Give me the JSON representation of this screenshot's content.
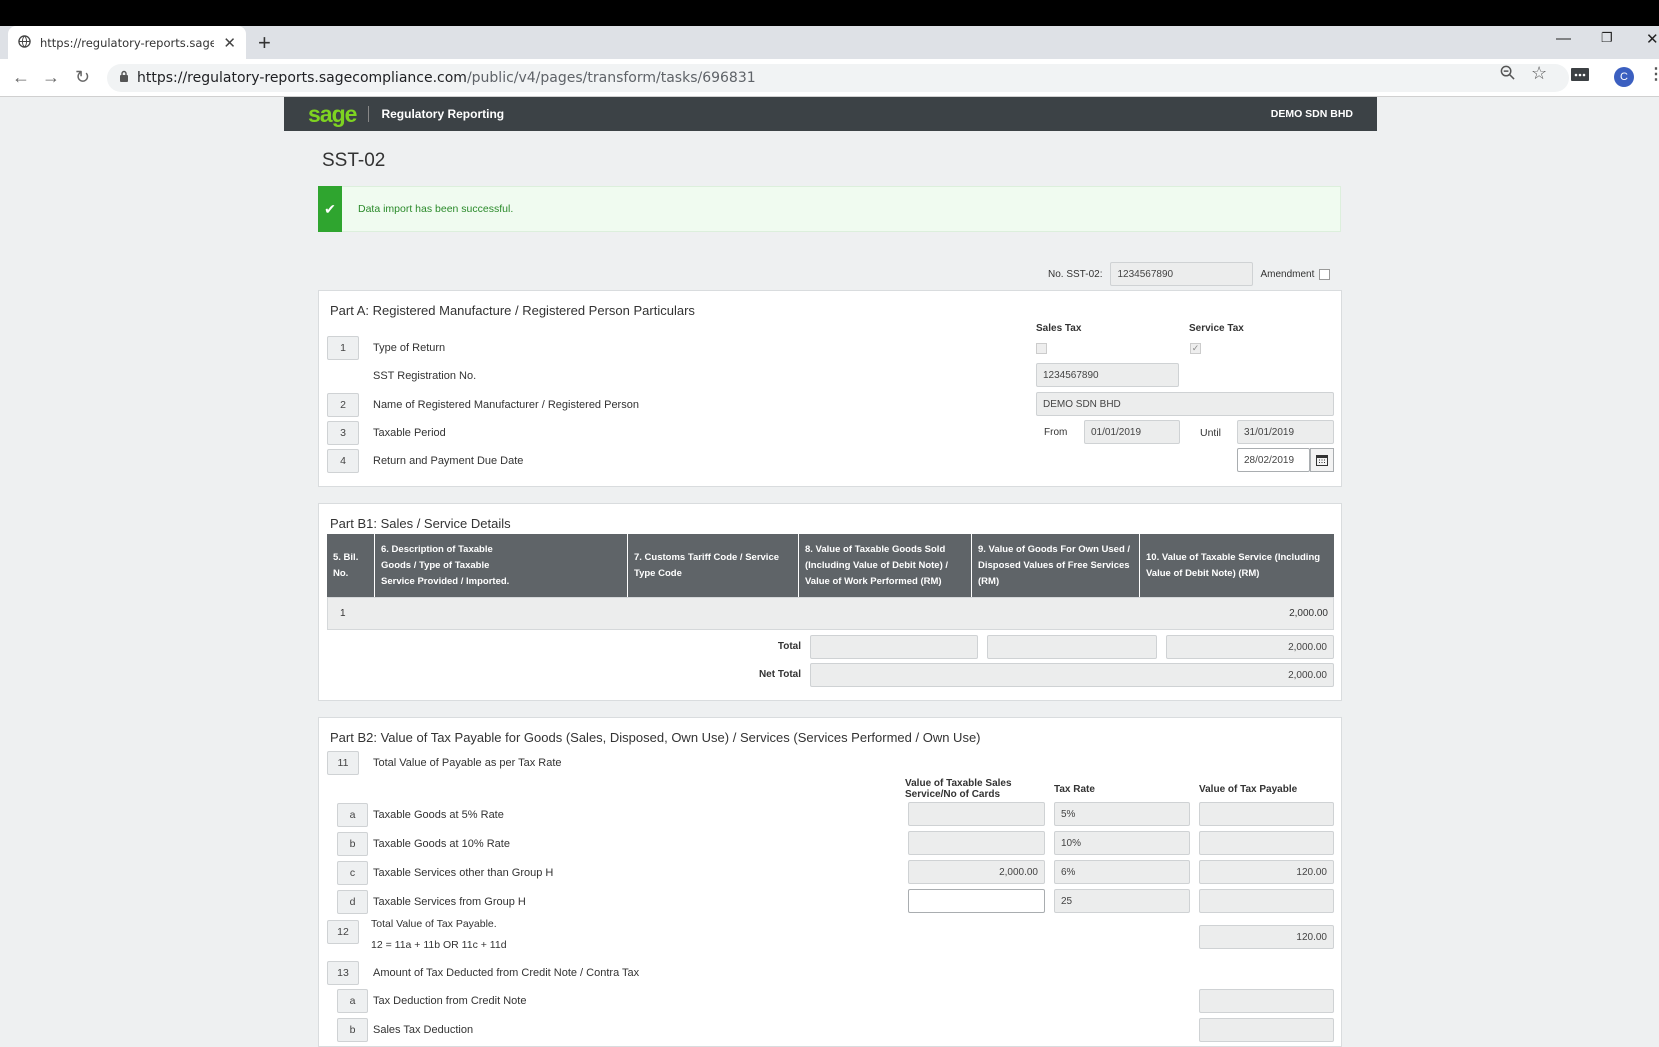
{
  "browser": {
    "tab_title": "https://regulatory-reports.sageco",
    "url_host": "https://regulatory-reports.sagecompliance.com",
    "url_path": "/public/v4/pages/transform/tasks/696831",
    "avatar_letter": "C"
  },
  "app": {
    "logo": "sage",
    "title": "Regulatory Reporting",
    "company": "DEMO SDN BHD",
    "brand_color": "#7ed321"
  },
  "page": {
    "title": "SST-02",
    "alert": "Data import has been successful.",
    "sst_no_label": "No. SST-02:",
    "sst_no_value": "1234567890",
    "amendment_label": "Amendment"
  },
  "part_a": {
    "title": "Part A: Registered Manufacture / Registered Person Particulars",
    "sales_tax_label": "Sales Tax",
    "service_tax_label": "Service Tax",
    "sales_tax_checked": false,
    "service_tax_checked": true,
    "rows": [
      {
        "num": "1",
        "label": "Type of Return"
      },
      {
        "num": "",
        "label": "SST Registration No."
      },
      {
        "num": "2",
        "label": "Name of Registered Manufacturer / Registered Person"
      },
      {
        "num": "3",
        "label": "Taxable Period"
      },
      {
        "num": "4",
        "label": "Return and Payment Due Date"
      }
    ],
    "sst_reg_no": "1234567890",
    "name": "DEMO SDN BHD",
    "from_label": "From",
    "from_value": "01/01/2019",
    "until_label": "Until",
    "until_value": "31/01/2019",
    "due_date": "28/02/2019"
  },
  "part_b1": {
    "title": "Part B1: Sales / Service Details",
    "columns": [
      "5. Bil. No.",
      "6. Description of Taxable Goods / Type of Taxable Service Provided / Imported.",
      "7. Customs Tariff Code / Service Type Code",
      "8. Value of Taxable Goods Sold (Including Value of Debit Note) / Value of Work Performed (RM)",
      "9. Value of Goods For Own Used / Disposed Values of Free Services (RM)",
      "10. Value of Taxable Service (Including Value of Debit Note) (RM)"
    ],
    "row": {
      "no": "1",
      "value": "2,000.00"
    },
    "total_label": "Total",
    "total_value": "2,000.00",
    "net_total_label": "Net Total",
    "net_total_value": "2,000.00"
  },
  "part_b2": {
    "title": "Part B2: Value of Tax Payable for Goods (Sales, Disposed, Own Use) / Services (Services Performed / Own Use)",
    "item11": {
      "num": "11",
      "label": "Total Value of Payable as per Tax Rate"
    },
    "col_value": "Value of Taxable Sales Service/No of Cards",
    "col_rate": "Tax Rate",
    "col_payable": "Value of Tax Payable",
    "rows": [
      {
        "letter": "a",
        "label": "Taxable Goods at 5% Rate",
        "value": "",
        "rate": "5%",
        "payable": ""
      },
      {
        "letter": "b",
        "label": "Taxable Goods at 10% Rate",
        "value": "",
        "rate": "10%",
        "payable": ""
      },
      {
        "letter": "c",
        "label": "Taxable Services other than Group H",
        "value": "2,000.00",
        "rate": "6%",
        "payable": "120.00"
      },
      {
        "letter": "d",
        "label": "Taxable Services from Group H",
        "value": "",
        "rate": "25",
        "payable": ""
      }
    ],
    "item12": {
      "num": "12",
      "label": "Total Value of Tax Payable.",
      "formula": "12 = 11a + 11b OR 11c + 11d",
      "value": "120.00"
    },
    "item13": {
      "num": "13",
      "label": "Amount of Tax Deducted from Credit Note / Contra Tax"
    },
    "sub13": [
      {
        "letter": "a",
        "label": "Tax Deduction from Credit Note"
      },
      {
        "letter": "b",
        "label": "Sales Tax Deduction"
      }
    ]
  }
}
